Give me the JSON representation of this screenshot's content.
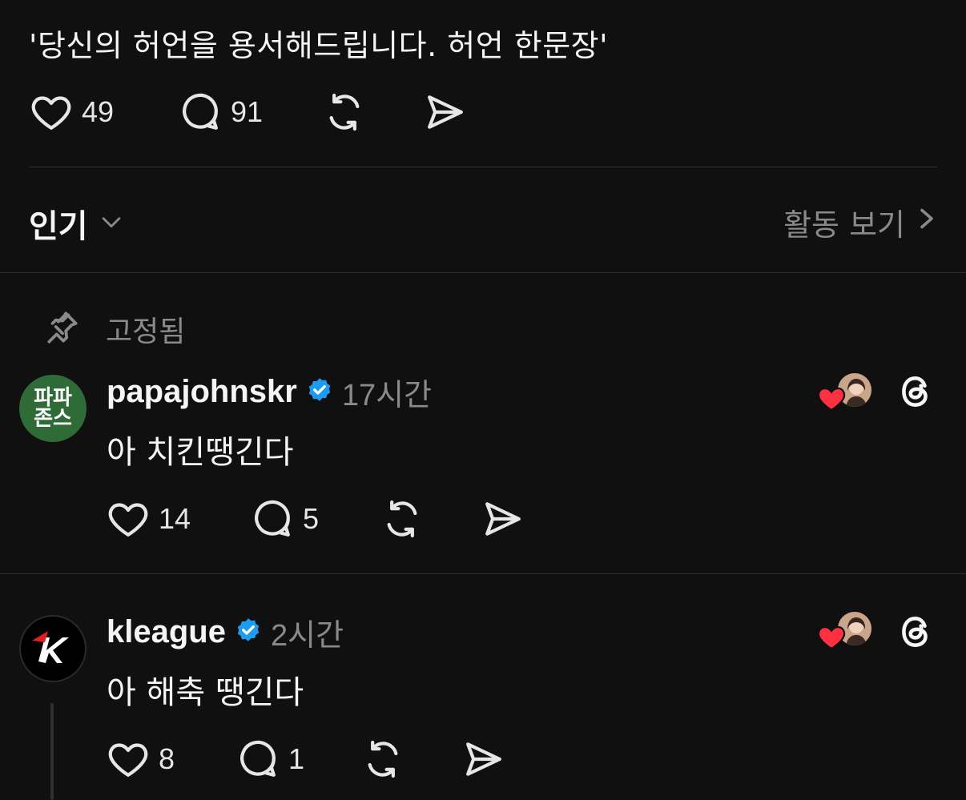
{
  "post": {
    "text": "'당신의 허언을 용서해드립니다. 허언 한문장'",
    "likes": "49",
    "comments": "91"
  },
  "sort": {
    "label": "인기",
    "activity_label": "활동 보기"
  },
  "pinned_label": "고정됨",
  "replies": [
    {
      "username": "papajohnskr",
      "time": "17시간",
      "text": "아 치킨땡긴다",
      "likes": "14",
      "comments": "5",
      "avatar_text_1": "파파",
      "avatar_text_2": "존스"
    },
    {
      "username": "kleague",
      "time": "2시간",
      "text": "아 해축 땡긴다",
      "likes": "8",
      "comments": "1"
    }
  ],
  "colors": {
    "background": "#101010",
    "verified": "#1d9bf0",
    "heart": "#ff3040",
    "papajohns_green": "#2e6b36"
  }
}
